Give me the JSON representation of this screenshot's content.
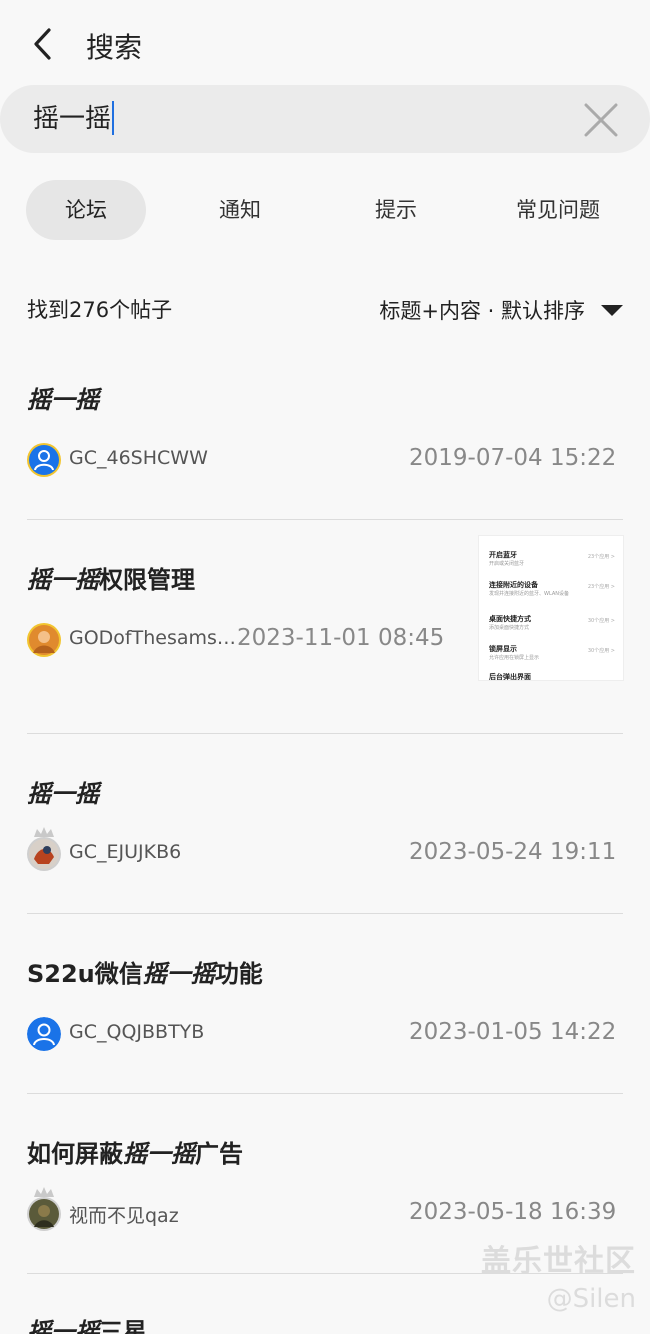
{
  "header": {
    "title": "搜索"
  },
  "search": {
    "query": "摇一摇"
  },
  "tabs": [
    {
      "label": "论坛",
      "active": true
    },
    {
      "label": "通知",
      "active": false
    },
    {
      "label": "提示",
      "active": false
    },
    {
      "label": "常见问题",
      "active": false
    }
  ],
  "results": {
    "count_text": "找到276个帖子",
    "sort_text": "标题+内容 · 默认排序"
  },
  "posts": [
    {
      "title_prefix": "",
      "title_highlight": "摇一摇",
      "title_suffix": "",
      "author": "GC_46SHCWW",
      "date": "2019-07-04 15:22"
    },
    {
      "title_prefix": "",
      "title_highlight": "摇一摇",
      "title_suffix": "权限管理",
      "author": "GODofThesams…",
      "date": "2023-11-01 08:45"
    },
    {
      "title_prefix": "",
      "title_highlight": "摇一摇",
      "title_suffix": "",
      "author": "GC_EJUJKB6",
      "date": "2023-05-24 19:11"
    },
    {
      "title_prefix": "S22u微信",
      "title_highlight": "摇一摇",
      "title_suffix": "功能",
      "author": "GC_QQJBBTYB",
      "date": "2023-01-05 14:22"
    },
    {
      "title_prefix": "如何屏蔽",
      "title_highlight": "摇一摇",
      "title_suffix": "广告",
      "author": "视而不见qaz",
      "date": "2023-05-18 16:39"
    },
    {
      "title_prefix": "",
      "title_highlight": "摇一摇",
      "title_suffix": "三星"
    }
  ],
  "thumbnail": {
    "rows": [
      {
        "title": "开启蓝牙",
        "sub": "开启或关闭蓝牙",
        "right": "23个应用 >"
      },
      {
        "title": "连接附近的设备",
        "sub": "发现并连接附近的蓝牙、WLAN设备",
        "right": "23个应用 >"
      },
      {
        "title": "桌面快捷方式",
        "sub": "添加桌面快捷方式",
        "right": "30个应用 >"
      },
      {
        "title": "锁屏显示",
        "sub": "允许应用在锁屏上显示",
        "right": "30个应用 >"
      },
      {
        "title": "后台弹出界面",
        "sub": "",
        "right": ""
      }
    ]
  },
  "watermark": {
    "line1": "盖乐世社区",
    "line2": "@Silen"
  },
  "colors": {
    "accent_caret": "#1f6fe0",
    "avatar_blue": "#1a73e8",
    "avatar_ring_yellow": "#f2c530"
  }
}
